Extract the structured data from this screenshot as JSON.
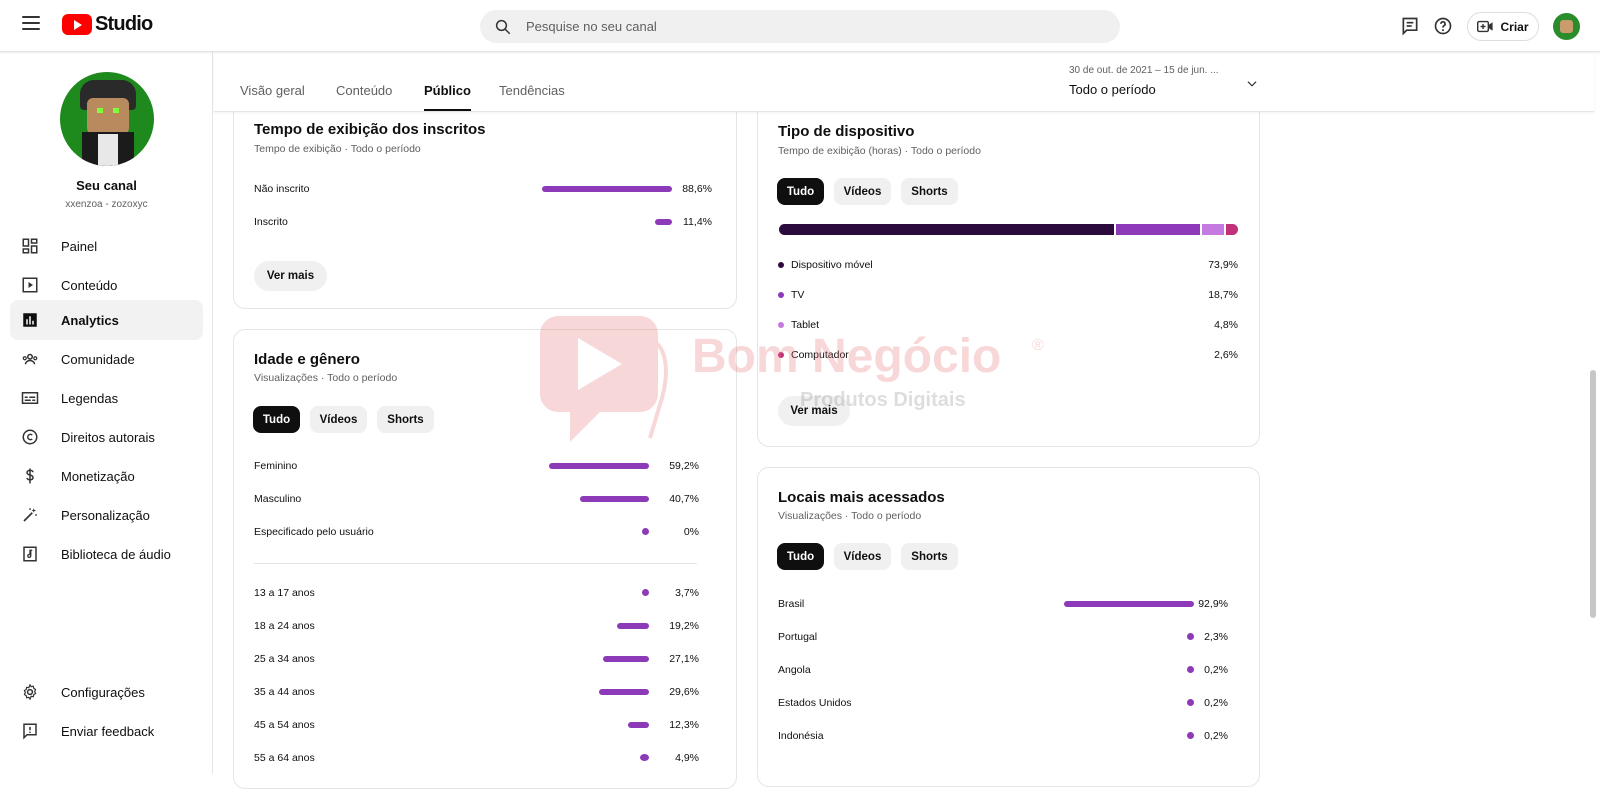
{
  "header": {
    "logo_text": "Studio",
    "search_placeholder": "Pesquise no seu canal",
    "create_label": "Criar"
  },
  "sidebar": {
    "channel_name": "Seu canal",
    "channel_handle": "xxenzoa - zozoxyc",
    "items": [
      {
        "label": "Painel",
        "icon": "dashboard-icon"
      },
      {
        "label": "Conteúdo",
        "icon": "content-icon"
      },
      {
        "label": "Analytics",
        "icon": "analytics-icon",
        "active": true
      },
      {
        "label": "Comunidade",
        "icon": "community-icon"
      },
      {
        "label": "Legendas",
        "icon": "subtitles-icon"
      },
      {
        "label": "Direitos autorais",
        "icon": "copyright-icon"
      },
      {
        "label": "Monetização",
        "icon": "monetization-icon"
      },
      {
        "label": "Personalização",
        "icon": "customization-icon"
      },
      {
        "label": "Biblioteca de áudio",
        "icon": "audio-library-icon"
      }
    ],
    "bottom_items": [
      {
        "label": "Configurações",
        "icon": "settings-icon"
      },
      {
        "label": "Enviar feedback",
        "icon": "feedback-icon"
      }
    ]
  },
  "tabs": [
    {
      "label": "Visão geral"
    },
    {
      "label": "Conteúdo"
    },
    {
      "label": "Público",
      "active": true
    },
    {
      "label": "Tendências"
    }
  ],
  "period": {
    "range": "30 de out. de 2021 – 15 de jun. ...",
    "label": "Todo o período"
  },
  "subscribers_card": {
    "title": "Tempo de exibição dos inscritos",
    "subtitle": "Tempo de exibição · Todo o período",
    "rows": [
      {
        "label": "Não inscrito",
        "value": "88,6%",
        "pct": 88.6
      },
      {
        "label": "Inscrito",
        "value": "11,4%",
        "pct": 11.4
      }
    ],
    "more_label": "Ver mais"
  },
  "age_gender_card": {
    "title": "Idade e gênero",
    "subtitle": "Visualizações · Todo o período",
    "filters": [
      "Tudo",
      "Vídeos",
      "Shorts"
    ],
    "gender_rows": [
      {
        "label": "Feminino",
        "value": "59,2%",
        "pct": 59.2
      },
      {
        "label": "Masculino",
        "value": "40,7%",
        "pct": 40.7
      },
      {
        "label": "Especificado pelo usuário",
        "value": "0%",
        "pct": 0
      }
    ],
    "age_rows": [
      {
        "label": "13 a 17 anos",
        "value": "3,7%",
        "pct": 3.7
      },
      {
        "label": "18 a 24 anos",
        "value": "19,2%",
        "pct": 19.2
      },
      {
        "label": "25 a 34 anos",
        "value": "27,1%",
        "pct": 27.1
      },
      {
        "label": "35 a 44 anos",
        "value": "29,6%",
        "pct": 29.6
      },
      {
        "label": "45 a 54 anos",
        "value": "12,3%",
        "pct": 12.3
      },
      {
        "label": "55 a 64 anos",
        "value": "4,9%",
        "pct": 4.9
      }
    ]
  },
  "device_card": {
    "title": "Tipo de dispositivo",
    "subtitle": "Tempo de exibição (horas) · Todo o período",
    "filters": [
      "Tudo",
      "Vídeos",
      "Shorts"
    ],
    "rows": [
      {
        "label": "Dispositivo móvel",
        "value": "73,9%",
        "pct": 73.9,
        "color": "#2b0a3d"
      },
      {
        "label": "TV",
        "value": "18,7%",
        "pct": 18.7,
        "color": "#8c3ab8"
      },
      {
        "label": "Tablet",
        "value": "4,8%",
        "pct": 4.8,
        "color": "#c47ae0"
      },
      {
        "label": "Computador",
        "value": "2,6%",
        "pct": 2.6,
        "color": "#c2307a"
      }
    ],
    "more_label": "Ver mais"
  },
  "locations_card": {
    "title": "Locais mais acessados",
    "subtitle": "Visualizações · Todo o período",
    "filters": [
      "Tudo",
      "Vídeos",
      "Shorts"
    ],
    "rows": [
      {
        "label": "Brasil",
        "value": "92,9%",
        "pct": 92.9
      },
      {
        "label": "Portugal",
        "value": "2,3%",
        "pct": 2.3
      },
      {
        "label": "Angola",
        "value": "0,2%",
        "pct": 0.2
      },
      {
        "label": "Estados Unidos",
        "value": "0,2%",
        "pct": 0.2
      },
      {
        "label": "Indonésia",
        "value": "0,2%",
        "pct": 0.2
      }
    ]
  },
  "watermark": {
    "brand": "Bom Negócio",
    "tagline": "Produtos Digitais",
    "mark": "®"
  },
  "colors": {
    "accent_bar": "#8c3ab8",
    "brand_red": "#ff0000",
    "watermark_red": "#e57373"
  }
}
